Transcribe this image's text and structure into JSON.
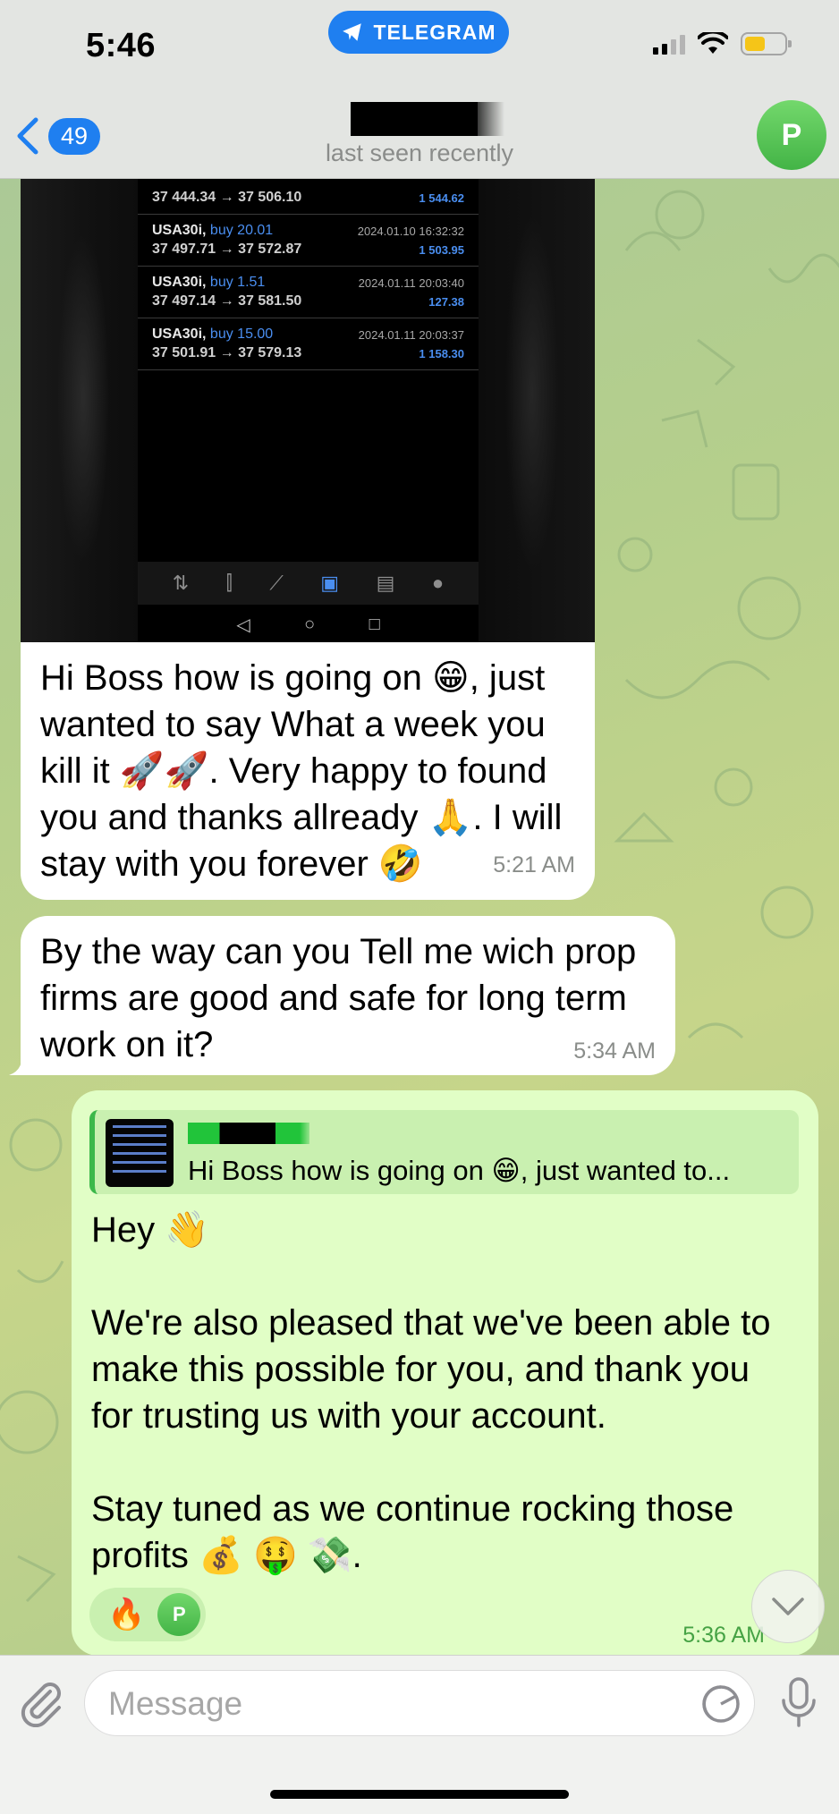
{
  "status_bar": {
    "time": "5:46",
    "app_pill": "TELEGRAM"
  },
  "header": {
    "back_count": "49",
    "subtitle": "last seen recently",
    "avatar_initial": "P"
  },
  "messages": {
    "screenshot_trades": [
      {
        "symbol": "",
        "side": "",
        "prices": "37 444.34 → 37 506.10",
        "date": "",
        "profit": "1 544.62"
      },
      {
        "symbol": "USA30i,",
        "side": "buy 20.01",
        "prices": "37 497.71 → 37 572.87",
        "date": "2024.01.10 16:32:32",
        "profit": "1 503.95"
      },
      {
        "symbol": "USA30i,",
        "side": "buy 1.51",
        "prices": "37 497.14 → 37 581.50",
        "date": "2024.01.11 20:03:40",
        "profit": "127.38"
      },
      {
        "symbol": "USA30i,",
        "side": "buy 15.00",
        "prices": "37 501.91 → 37 579.13",
        "date": "2024.01.11 20:03:37",
        "profit": "1 158.30"
      }
    ],
    "incoming_1": {
      "text": "Hi Boss how is going on 😁, just wanted to say What a week you kill it 🚀🚀. Very happy to found you and thanks allready 🙏. I will stay with you forever 🤣",
      "time": "5:21 AM"
    },
    "incoming_2": {
      "text": "By the way can you Tell me wich prop firms are good and safe for long term work on it?",
      "time": "5:34 AM"
    },
    "outgoing_1": {
      "reply_snippet": "Hi Boss how is going on 😁, just wanted to...",
      "line1": "Hey 👋",
      "line2": "We're also pleased that we've been able to make this possible for you, and thank you for trusting us with your account.",
      "line3": "Stay tuned as we continue rocking those profits 💰 🤑 💸.",
      "reaction_emoji": "🔥",
      "reaction_avatar": "P",
      "time": "5:36 AM"
    }
  },
  "input": {
    "placeholder": "Message"
  },
  "colors": {
    "accent": "#1f7ff0",
    "outgoing_bubble": "#e1fec6",
    "outgoing_time": "#45a244",
    "avatar_green": "#4cbc4e"
  }
}
